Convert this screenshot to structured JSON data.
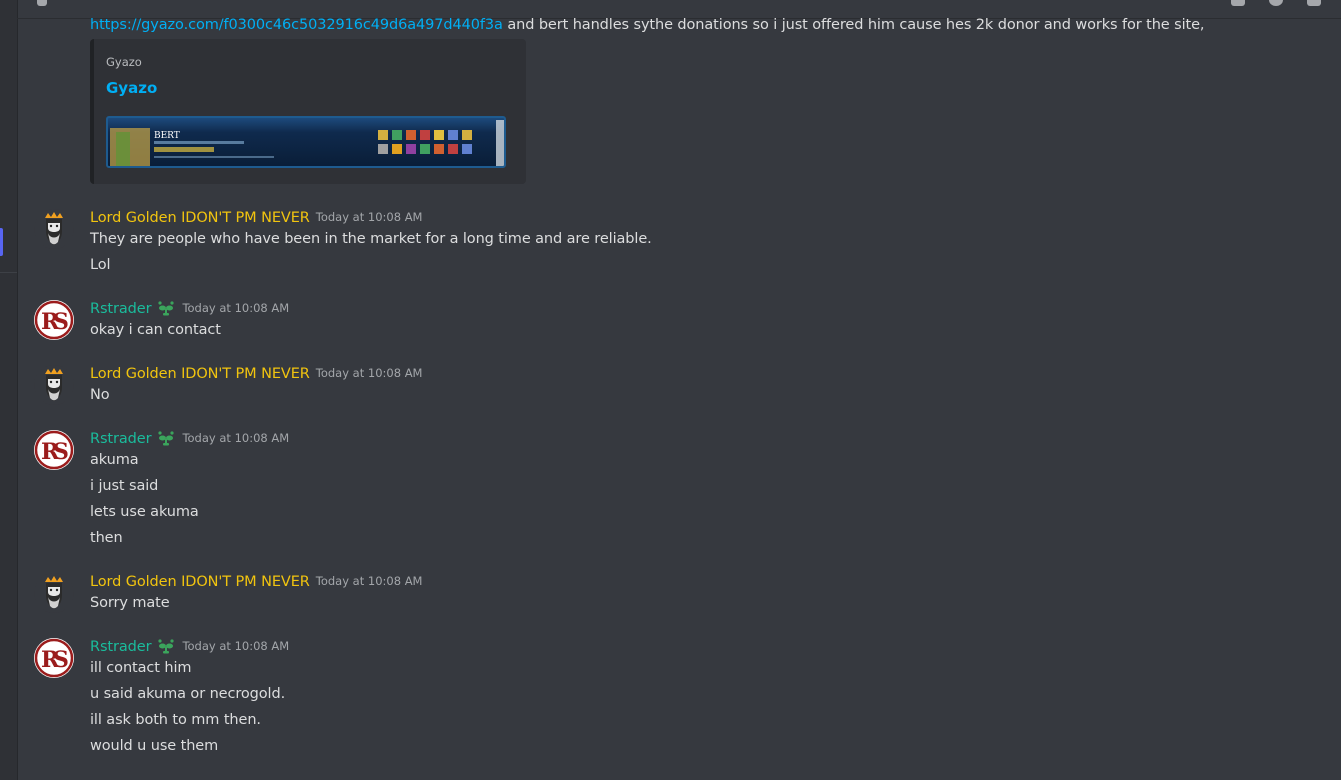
{
  "embed_message": {
    "link": "https://gyazo.com/f0300c46c5032916c49d6a497d440f3a",
    "text_after_link": " and bert handles sythe donations so i just offered him cause hes 2k donor and works for the site,",
    "embed": {
      "provider": "Gyazo",
      "title": "Gyazo",
      "thumbnail_text": "BERT"
    }
  },
  "messages": [
    {
      "author": "Lord Golden IDON'T PM NEVER",
      "timestamp": "Today at 10:08 AM",
      "lines": [
        "They are people who have been in the market for a long time and are reliable.",
        "Lol"
      ]
    },
    {
      "author": "Rstrader",
      "timestamp": "Today at 10:08 AM",
      "lines": [
        "okay i can contact"
      ]
    },
    {
      "author": "Lord Golden IDON'T PM NEVER",
      "timestamp": "Today at 10:08 AM",
      "lines": [
        "No"
      ]
    },
    {
      "author": "Rstrader",
      "timestamp": "Today at 10:08 AM",
      "lines": [
        "akuma",
        "i just said",
        "lets use akuma",
        "then"
      ]
    },
    {
      "author": "Lord Golden IDON'T PM NEVER",
      "timestamp": "Today at 10:08 AM",
      "lines": [
        "Sorry mate"
      ]
    },
    {
      "author": "Rstrader",
      "timestamp": "Today at 10:08 AM",
      "lines": [
        "ill contact him",
        "u said akuma or necrogold.",
        "ill ask both to mm then.",
        "would u use them"
      ]
    }
  ],
  "colors": {
    "background": "#36393f",
    "golden_name": "#f1c40f",
    "rstrader_name": "#1abc9c",
    "link": "#00aff4"
  },
  "icons": {
    "golden_avatar": "king-crown-avatar-icon",
    "rstrader_avatar": "rs-logo-avatar-icon",
    "rstrader_badge": "sprout-badge-icon"
  }
}
